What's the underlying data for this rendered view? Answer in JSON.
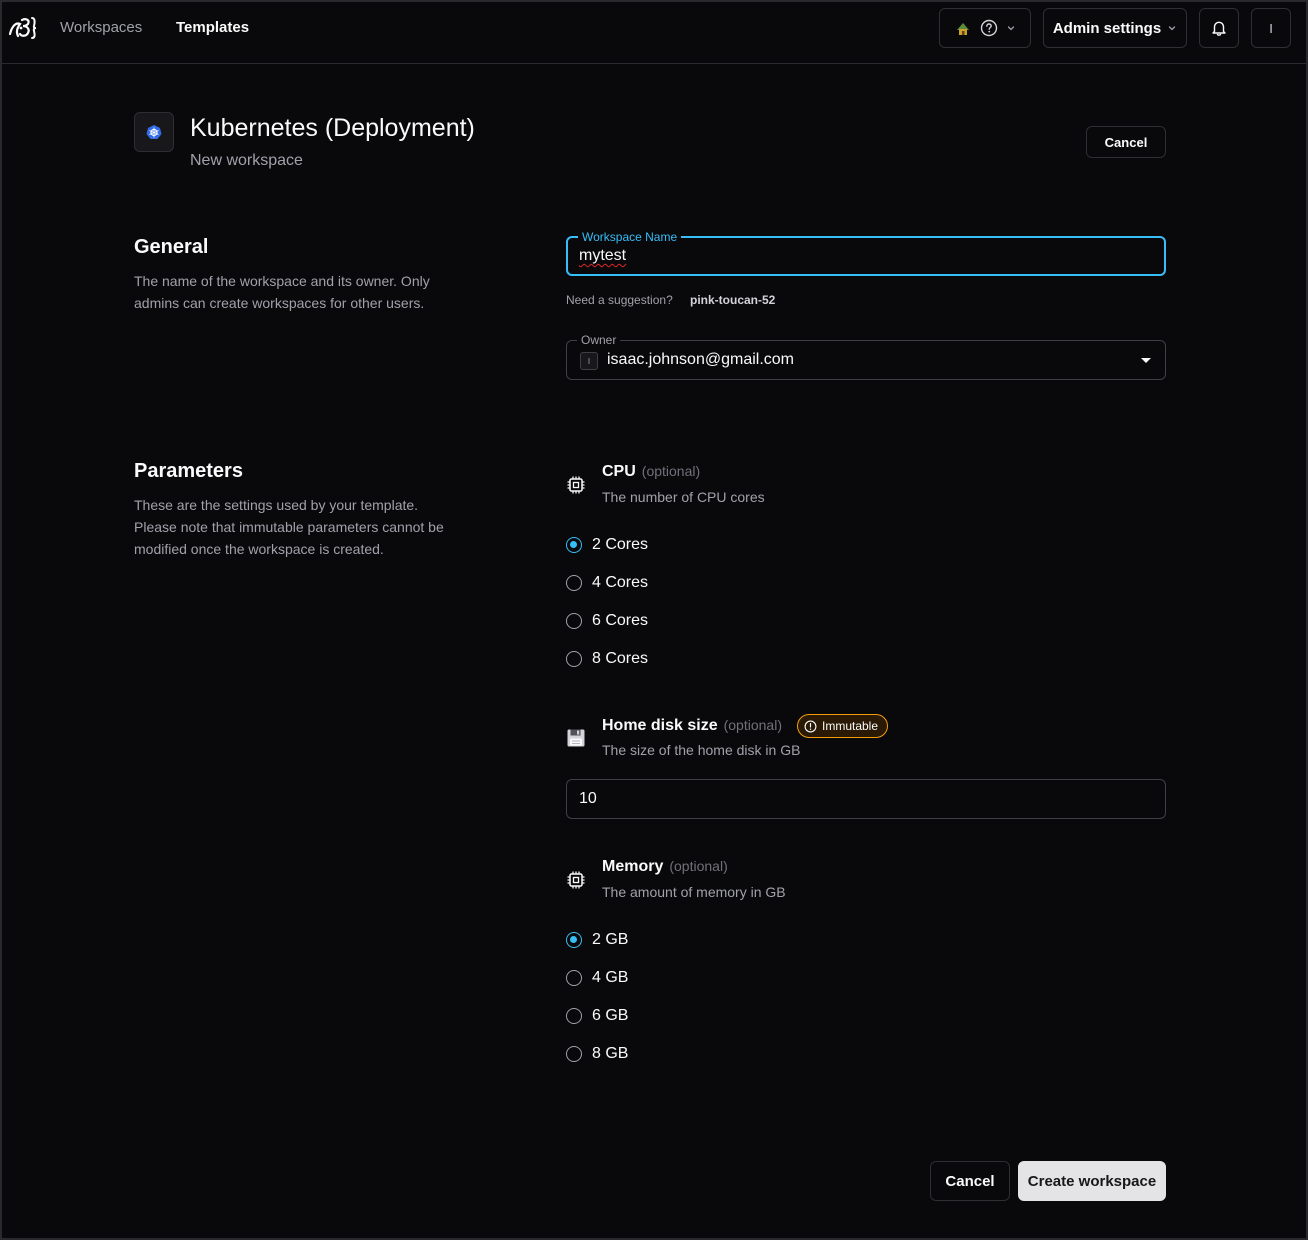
{
  "nav": {
    "workspaces": "Workspaces",
    "templates": "Templates",
    "admin_settings": "Admin settings",
    "user_initial": "I"
  },
  "header": {
    "title": "Kubernetes (Deployment)",
    "subtitle": "New workspace",
    "cancel": "Cancel"
  },
  "general": {
    "title": "General",
    "description": "The name of the workspace and its owner. Only admins can create workspaces for other users.",
    "name_label": "Workspace Name",
    "name_value": "mytest",
    "suggestion_prompt": "Need a suggestion?",
    "suggestion_value": "pink-toucan-52",
    "owner_label": "Owner",
    "owner_initial": "I",
    "owner_value": "isaac.johnson@gmail.com"
  },
  "parameters": {
    "title": "Parameters",
    "description": "These are the settings used by your template. Please note that immutable parameters cannot be modified once the workspace is created.",
    "optional": "(optional)",
    "cpu": {
      "name": "CPU",
      "description": "The number of CPU cores",
      "options": [
        "2 Cores",
        "4 Cores",
        "6 Cores",
        "8 Cores"
      ],
      "selected": "2 Cores"
    },
    "disk": {
      "name": "Home disk size",
      "badge": "Immutable",
      "description": "The size of the home disk in GB",
      "value": "10"
    },
    "memory": {
      "name": "Memory",
      "description": "The amount of memory in GB",
      "options": [
        "2 GB",
        "4 GB",
        "6 GB",
        "8 GB"
      ],
      "selected": "2 GB"
    }
  },
  "footer": {
    "cancel": "Cancel",
    "create": "Create workspace"
  },
  "colors": {
    "accent": "#38bdf8",
    "background": "#09090b",
    "immutable_badge": "#f59e0b"
  }
}
